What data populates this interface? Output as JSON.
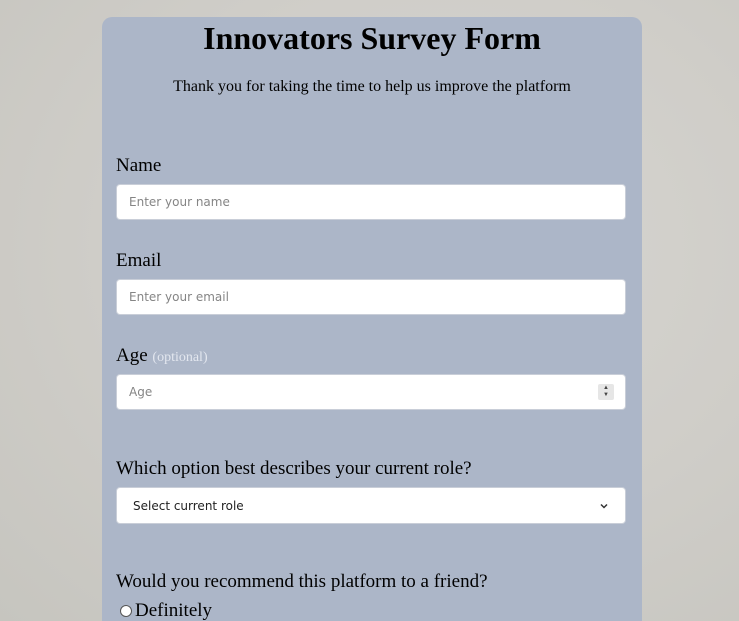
{
  "form": {
    "title": "Innovators Survey Form",
    "subtitle": "Thank you for taking the time to help us improve the platform",
    "name": {
      "label": "Name",
      "placeholder": "Enter your name"
    },
    "email": {
      "label": "Email",
      "placeholder": "Enter your email"
    },
    "age": {
      "label": "Age",
      "optional_text": "(optional)",
      "placeholder": "Age"
    },
    "role": {
      "question": "Which option best describes your current role?",
      "selected": "Select current role",
      "icon": "chevron-down-icon"
    },
    "recommend": {
      "question": "Would you recommend this platform to a friend?",
      "options": [
        "Definitely"
      ]
    }
  },
  "colors": {
    "card_background": "#acb6c8",
    "page_background": "#cfcdc8",
    "optional_text": "#e3e7ef"
  }
}
